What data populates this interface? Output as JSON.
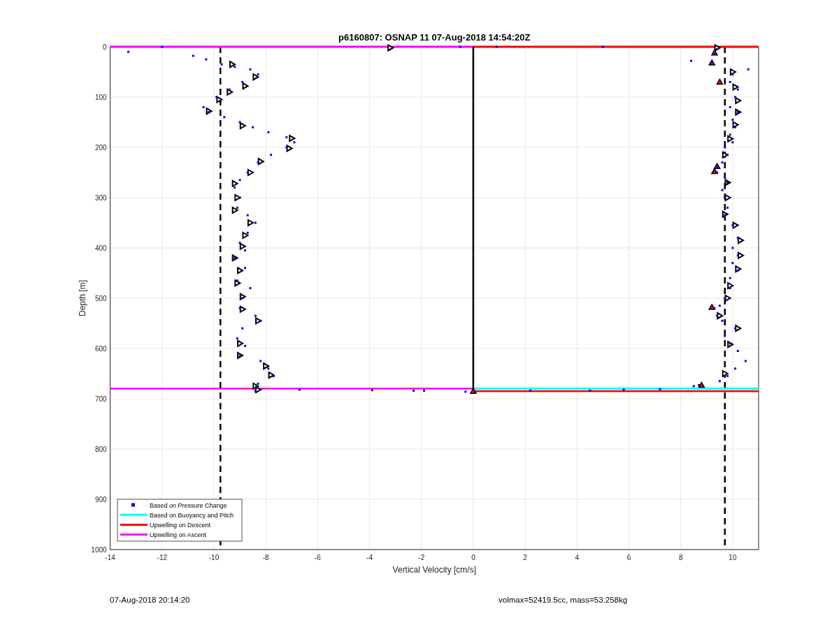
{
  "figure": {
    "chart_data": {
      "type": "scatter",
      "title": "p6160807: OSNAP 11 07-Aug-2018 14:54:20Z",
      "xlabel": "Vertical Velocity [cm/s]",
      "ylabel": "Depth [m]",
      "xlim": [
        -14,
        11
      ],
      "ylim": [
        1000,
        0
      ],
      "xticks": [
        -14,
        -12,
        -10,
        -8,
        -6,
        -4,
        -2,
        0,
        2,
        4,
        6,
        8,
        10
      ],
      "yticks": [
        0,
        100,
        200,
        300,
        400,
        500,
        600,
        700,
        800,
        900,
        1000
      ],
      "series": [
        {
          "name": "Based on Pressure Change",
          "marker": "square",
          "color": "#0000ff",
          "x": [
            -13.3,
            -12,
            -10.8,
            -10.3,
            -9.7,
            -9.2,
            -8.6,
            -8.3,
            -8.9,
            -9.4,
            -9.9,
            -10.4,
            -10.2,
            -9.6,
            -9.0,
            -8.5,
            -7.9,
            -7.2,
            -6.9,
            -7.2,
            -7.8,
            -8.3,
            -8.7,
            -9.0,
            -9.2,
            -9.0,
            -9.1,
            -8.7,
            -8.4,
            -8.7,
            -9.0,
            -8.8,
            -9.2,
            -8.8,
            -9.1,
            -8.6,
            -8.9,
            -9.0,
            -8.4,
            -8.2,
            -8.9,
            -9.1,
            -8.8,
            -9.0,
            -8.2,
            -7.9,
            -7.7,
            -8.3,
            -8.4,
            -6.7,
            -3.9,
            -2.3,
            -1.9,
            -0.3,
            -0.5,
            0.9,
            5.0,
            9.4,
            9.3,
            9.2,
            8.4,
            10.6,
            10.0,
            9.9,
            10.2,
            10.1,
            9.9,
            10.2,
            10.0,
            10.1,
            9.9,
            10.0,
            9.7,
            9.8,
            9.6,
            9.4,
            9.4,
            9.7,
            9.8,
            9.6,
            9.7,
            9.8,
            9.7,
            10.0,
            10.2,
            10.0,
            10.2,
            10.0,
            10.2,
            9.9,
            9.9,
            9.7,
            9.5,
            9.3,
            9.4,
            9.6,
            10.1,
            9.7,
            9.9,
            10.2,
            10.5,
            10.1,
            9.8,
            9.5,
            8.7,
            8.5,
            2.2,
            4.5,
            5.8,
            7.2
          ],
          "values": [
            10,
            0,
            18,
            25,
            35,
            40,
            45,
            55,
            70,
            85,
            100,
            120,
            130,
            140,
            150,
            160,
            170,
            180,
            190,
            200,
            215,
            230,
            250,
            265,
            280,
            300,
            320,
            335,
            350,
            370,
            390,
            405,
            420,
            440,
            465,
            480,
            500,
            520,
            535,
            545,
            560,
            580,
            595,
            615,
            625,
            640,
            655,
            670,
            685,
            682,
            683,
            684,
            684,
            686,
            0,
            0,
            0,
            5,
            15,
            30,
            28,
            45,
            55,
            70,
            85,
            100,
            120,
            130,
            145,
            160,
            175,
            190,
            200,
            215,
            230,
            240,
            250,
            260,
            270,
            285,
            300,
            320,
            335,
            355,
            380,
            400,
            415,
            430,
            445,
            460,
            480,
            500,
            515,
            520,
            535,
            545,
            560,
            575,
            590,
            605,
            625,
            640,
            655,
            665,
            673,
            675,
            684,
            684,
            682,
            681
          ]
        },
        {
          "name": "Based on Buoyancy and Pitch",
          "type": "line",
          "color": "#00ffff",
          "x": [
            0,
            11
          ],
          "values": [
            680,
            680
          ]
        },
        {
          "name": "Upwelling on Descent",
          "type": "line",
          "color": "#ff0000",
          "x": [
            0,
            11
          ],
          "values": [
            0,
            0
          ]
        },
        {
          "type": "line",
          "color": "#ff0000",
          "x": [
            0,
            11
          ],
          "values": [
            685,
            685
          ]
        },
        {
          "name": "Upwelling on Ascent",
          "type": "line",
          "color": "#ff00ff",
          "x": [
            -14,
            0
          ],
          "values": [
            0,
            0
          ]
        },
        {
          "type": "line",
          "color": "#ff00ff",
          "x": [
            -14,
            0
          ],
          "values": [
            680,
            680
          ]
        },
        {
          "type": "line",
          "color": "#000000",
          "x": [
            0,
            0
          ],
          "values": [
            0,
            685
          ]
        },
        {
          "marker": "triangle",
          "color": "#000000",
          "x": [
            -9.3,
            -8.4,
            -8.8,
            -9.4,
            -9.8,
            -10.2,
            -8.9,
            -7.0,
            -7.1,
            -8.2,
            -8.6,
            -9.2,
            -9.1,
            -9.2,
            -8.6,
            -8.8,
            -8.9,
            -9.2,
            -9.0,
            -9.1,
            -8.9,
            -8.9,
            -8.3,
            -9.0,
            -9.0,
            -8.0,
            -7.8,
            -8.4,
            -8.3,
            -3.2,
            9.4,
            10.0,
            10.1,
            10.2,
            10.2,
            10.1,
            9.9,
            9.7,
            9.8,
            9.8,
            9.7,
            10.1,
            10.3,
            10.3,
            10.2,
            9.9,
            9.8,
            9.5,
            10.2,
            9.9,
            9.7
          ],
          "values": [
            35,
            60,
            78,
            90,
            105,
            128,
            157,
            182,
            202,
            228,
            250,
            272,
            300,
            325,
            350,
            375,
            397,
            420,
            445,
            470,
            497,
            522,
            545,
            590,
            614,
            635,
            653,
            675,
            682,
            2,
            2,
            50,
            80,
            107,
            130,
            155,
            183,
            215,
            270,
            300,
            333,
            355,
            385,
            415,
            442,
            475,
            500,
            535,
            560,
            592,
            650
          ]
        },
        {
          "marker": "triangle",
          "color": "#ff0000",
          "x": [
            9.3,
            9.2,
            9.5,
            9.4,
            9.3,
            9.2,
            8.8,
            0
          ],
          "values": [
            12,
            32,
            70,
            238,
            248,
            518,
            673,
            685
          ]
        }
      ],
      "ref_lines": [
        {
          "axis": "x",
          "value": -9.75,
          "color": "#000000"
        },
        {
          "axis": "x",
          "value": 9.7,
          "color": "#000000"
        }
      ],
      "grid": true,
      "legend": true
    }
  },
  "footer": {
    "left": "07-Aug-2018 20:14:20",
    "right": "volmax=52419.5cc, mass=53.258kg"
  }
}
